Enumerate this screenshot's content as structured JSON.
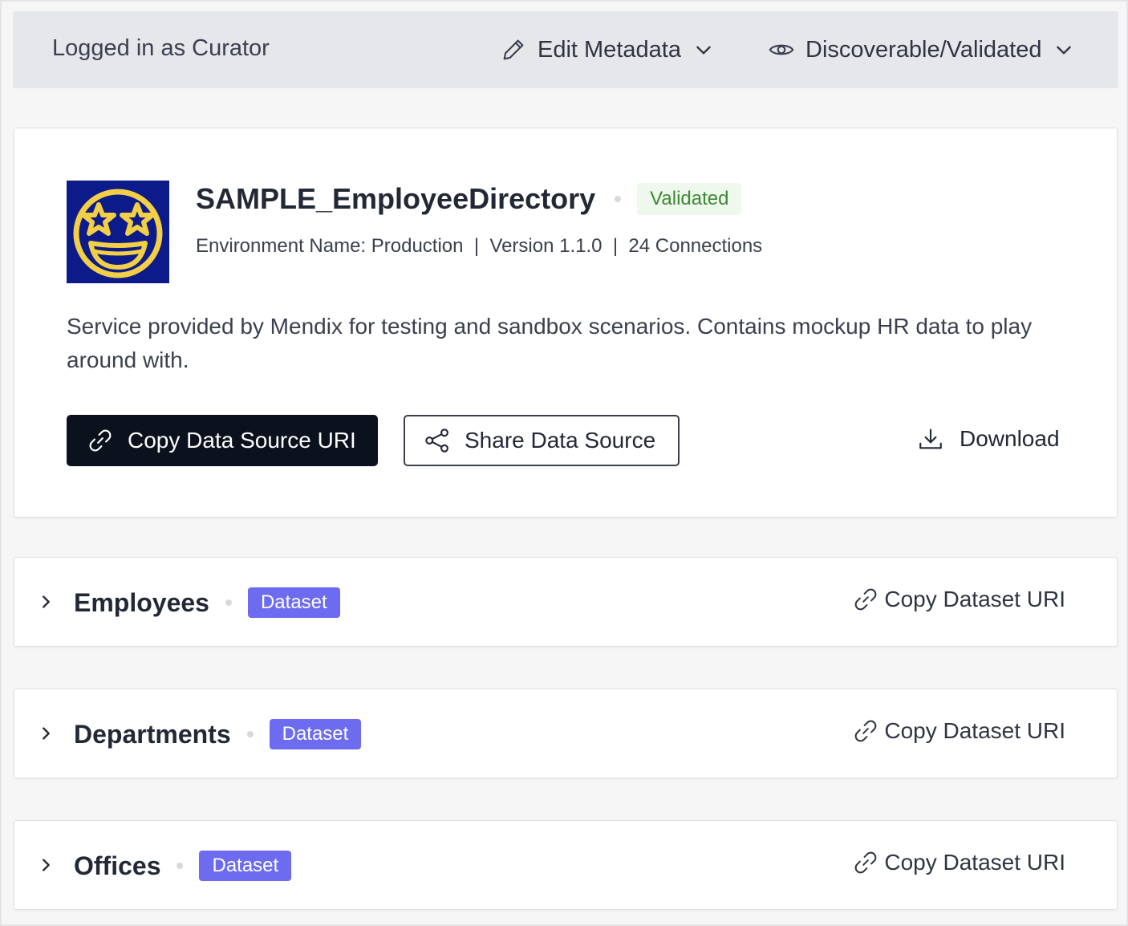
{
  "header": {
    "user_label": "Logged in as Curator",
    "edit_menu": {
      "label": "Edit Metadata",
      "icon": "pencil-icon"
    },
    "visibility_menu": {
      "label": "Discoverable/Validated",
      "icon": "eye-icon"
    }
  },
  "data_source": {
    "name": "SAMPLE_EmployeeDirectory",
    "status": "Validated",
    "meta": "Environment Name: Production  |  Version 1.1.0  |  24 Connections",
    "description": "Service provided by Mendix for testing and sandbox scenarios. Contains mockup HR data to play around with.",
    "actions": {
      "copy_uri": "Copy Data Source URI",
      "share": "Share Data Source",
      "download": "Download"
    }
  },
  "datasets": [
    {
      "name": "Employees",
      "badge": "Dataset",
      "action": "Copy Dataset URI"
    },
    {
      "name": "Departments",
      "badge": "Dataset",
      "action": "Copy Dataset URI"
    },
    {
      "name": "Offices",
      "badge": "Dataset",
      "action": "Copy Dataset URI"
    }
  ],
  "colors": {
    "primary_button": "#0c111e",
    "validated_bg": "#eef8ec",
    "validated_text": "#3d8a34",
    "dataset_badge": "#6d6cf0",
    "avatar_bg": "#0d1a8a",
    "avatar_face": "#f2cf45"
  }
}
